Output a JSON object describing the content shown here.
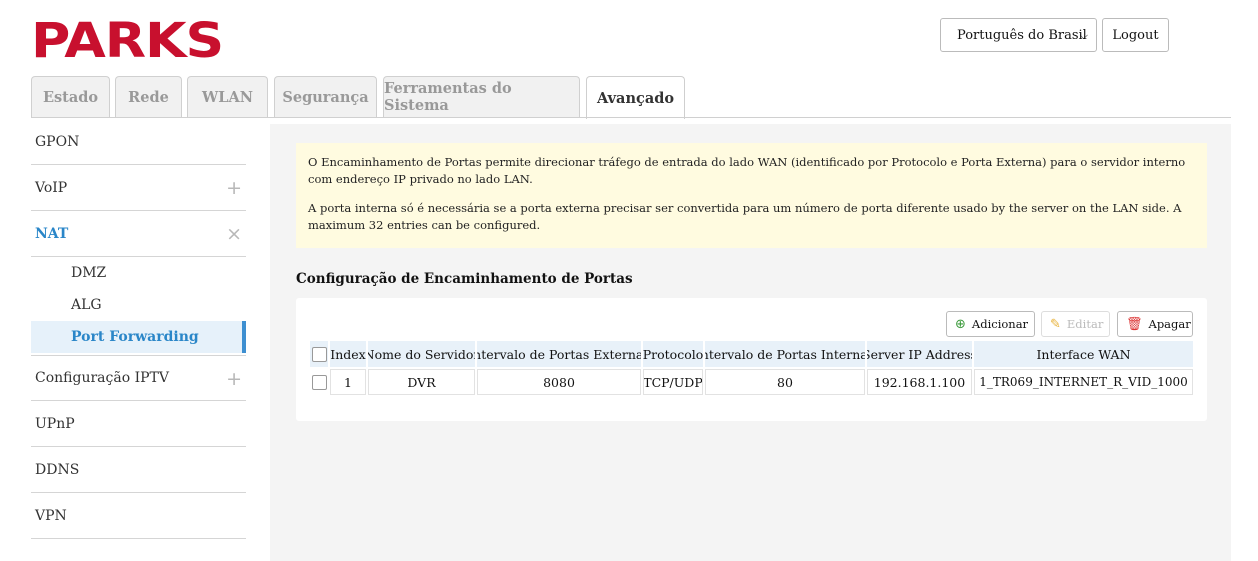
{
  "header": {
    "logo_text": "PARKS",
    "language_selected": "Português do Brasil",
    "logout_label": "Logout"
  },
  "tabs": [
    {
      "label": "Estado",
      "active": false
    },
    {
      "label": "Rede",
      "active": false
    },
    {
      "label": "WLAN",
      "active": false
    },
    {
      "label": "Segurança",
      "active": false
    },
    {
      "label": "Ferramentas do Sistema",
      "active": false
    },
    {
      "label": "Avançado",
      "active": true
    }
  ],
  "sidebar": {
    "items": [
      {
        "label": "GPON",
        "toggle": ""
      },
      {
        "label": "VoIP",
        "toggle": "+"
      },
      {
        "label": "NAT",
        "toggle": "×"
      },
      {
        "label": "Configuração IPTV",
        "toggle": "+"
      },
      {
        "label": "UPnP",
        "toggle": ""
      },
      {
        "label": "DDNS",
        "toggle": ""
      },
      {
        "label": "VPN",
        "toggle": ""
      }
    ],
    "nat_sub": [
      {
        "label": "DMZ"
      },
      {
        "label": "ALG"
      },
      {
        "label": "Port Forwarding"
      }
    ]
  },
  "notice": {
    "p1": "O Encaminhamento de Portas permite direcionar tráfego de entrada do lado WAN (identificado por Protocolo e Porta Externa) para o servidor interno com endereço IP privado no lado LAN.",
    "p2": "A porta interna só é necessária se a porta externa precisar ser convertida para um número de porta diferente usado by the server on the LAN side. A maximum 32 entries can be configured."
  },
  "section_title": "Configuração de Encaminhamento de Portas",
  "actions": {
    "add": "Adicionar",
    "edit": "Editar",
    "delete": "Apagar"
  },
  "table": {
    "headers": [
      "Index",
      "Nome do Servidor",
      "Intervalo de Portas Externas",
      "Protocolo",
      "Intervalo de Portas Internas",
      "Server IP Address",
      "Interface WAN"
    ],
    "rows": [
      [
        "1",
        "DVR",
        "8080",
        "TCP/UDP",
        "80",
        "192.168.1.100",
        "1_TR069_INTERNET_R_VID_1000"
      ]
    ]
  },
  "colors": {
    "brand_red": "#c8102e",
    "active_blue": "#2a86c8",
    "notice_bg": "#fffbe0"
  }
}
